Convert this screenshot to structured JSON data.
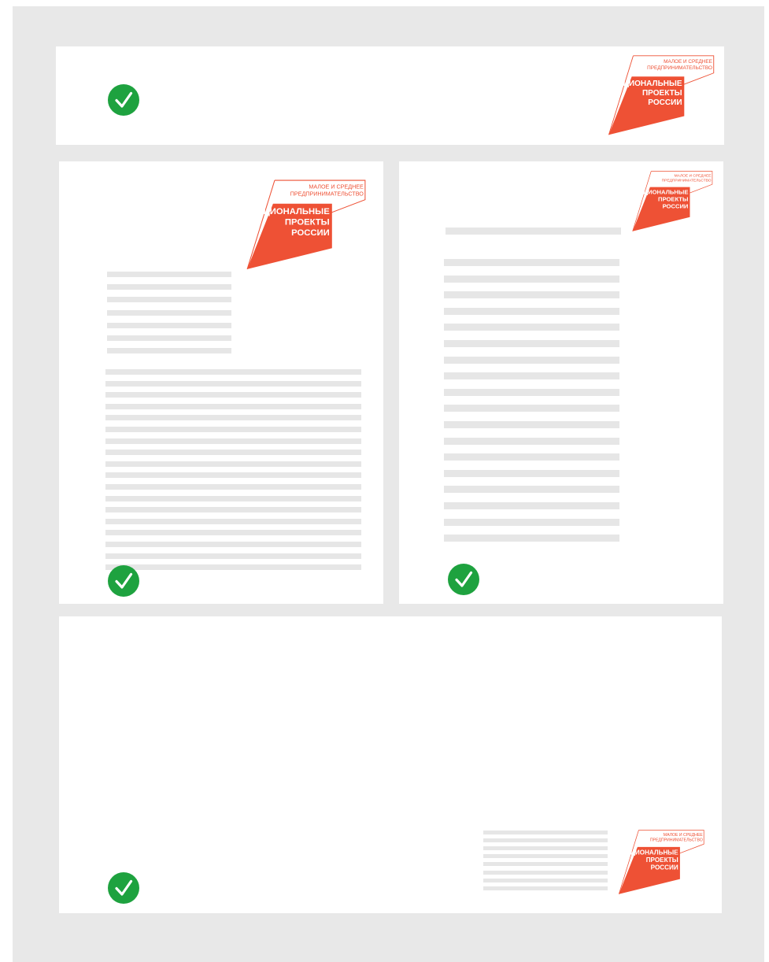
{
  "logo": {
    "line1": "МАЛОЕ И СРЕДНЕЕ",
    "line2": "ПРЕДПРИНИМАТЕЛЬСТВО",
    "line3": "НАЦИОНАЛЬНЫЕ",
    "line4": "ПРОЕКТЫ",
    "line5": "РОССИИ"
  },
  "colors": {
    "brand_red": "#ee5135",
    "check_green": "#1ea23f",
    "placeholder_line": "#e6e6e6",
    "background": "#e8e8e8"
  },
  "layouts": [
    {
      "name": "horizontal-banner",
      "check": "correct"
    },
    {
      "name": "portrait-logo-top-left",
      "check": "correct"
    },
    {
      "name": "portrait-logo-top-right",
      "check": "correct"
    },
    {
      "name": "landscape-logo-bottom-right",
      "check": "correct"
    }
  ]
}
